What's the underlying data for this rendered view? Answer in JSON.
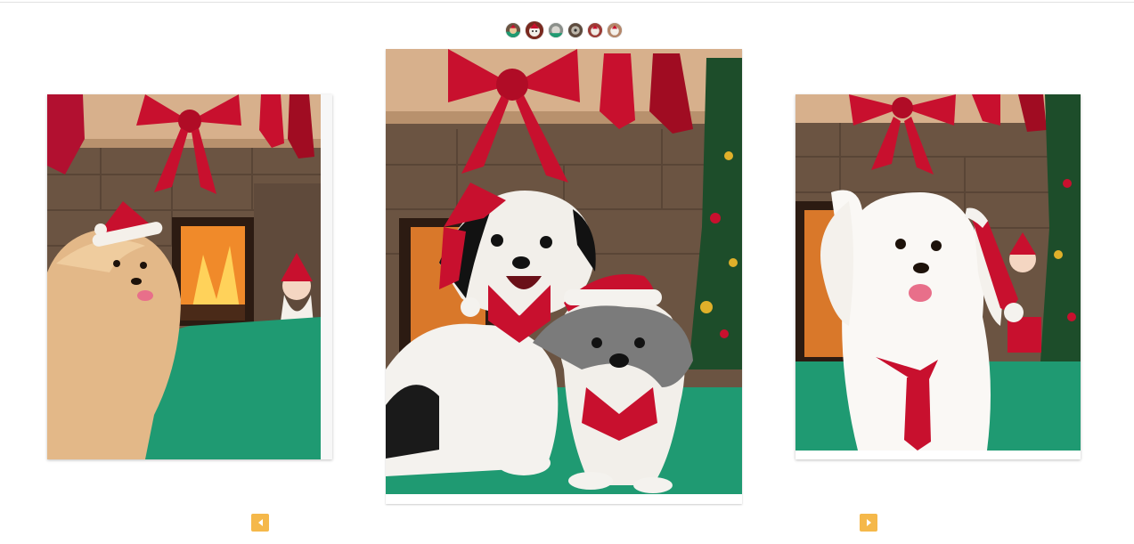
{
  "gallery": {
    "thumbnails": [
      {
        "photo": "dog-photo-1",
        "active": false
      },
      {
        "photo": "dog-photo-2",
        "active": true
      },
      {
        "photo": "dog-photo-3",
        "active": false
      },
      {
        "photo": "dog-photo-4",
        "active": false
      },
      {
        "photo": "dog-photo-5",
        "active": false
      },
      {
        "photo": "dog-photo-6",
        "active": false
      }
    ],
    "slides": {
      "left": {
        "subject": "pomeranian-santa-hat-photo"
      },
      "center": {
        "subject": "two-shih-tzus-santa-hats-photo"
      },
      "right": {
        "subject": "maltese-santa-hat-tie-photo"
      }
    },
    "controls": {
      "prev_icon": "triangle-left-icon",
      "next_icon": "triangle-right-icon"
    }
  },
  "colors": {
    "accent": "#f5b84a",
    "bow_red": "#c8102e",
    "blanket_green": "#1f9a72",
    "brick": "#6b5442",
    "mantel": "#d7b08c"
  }
}
